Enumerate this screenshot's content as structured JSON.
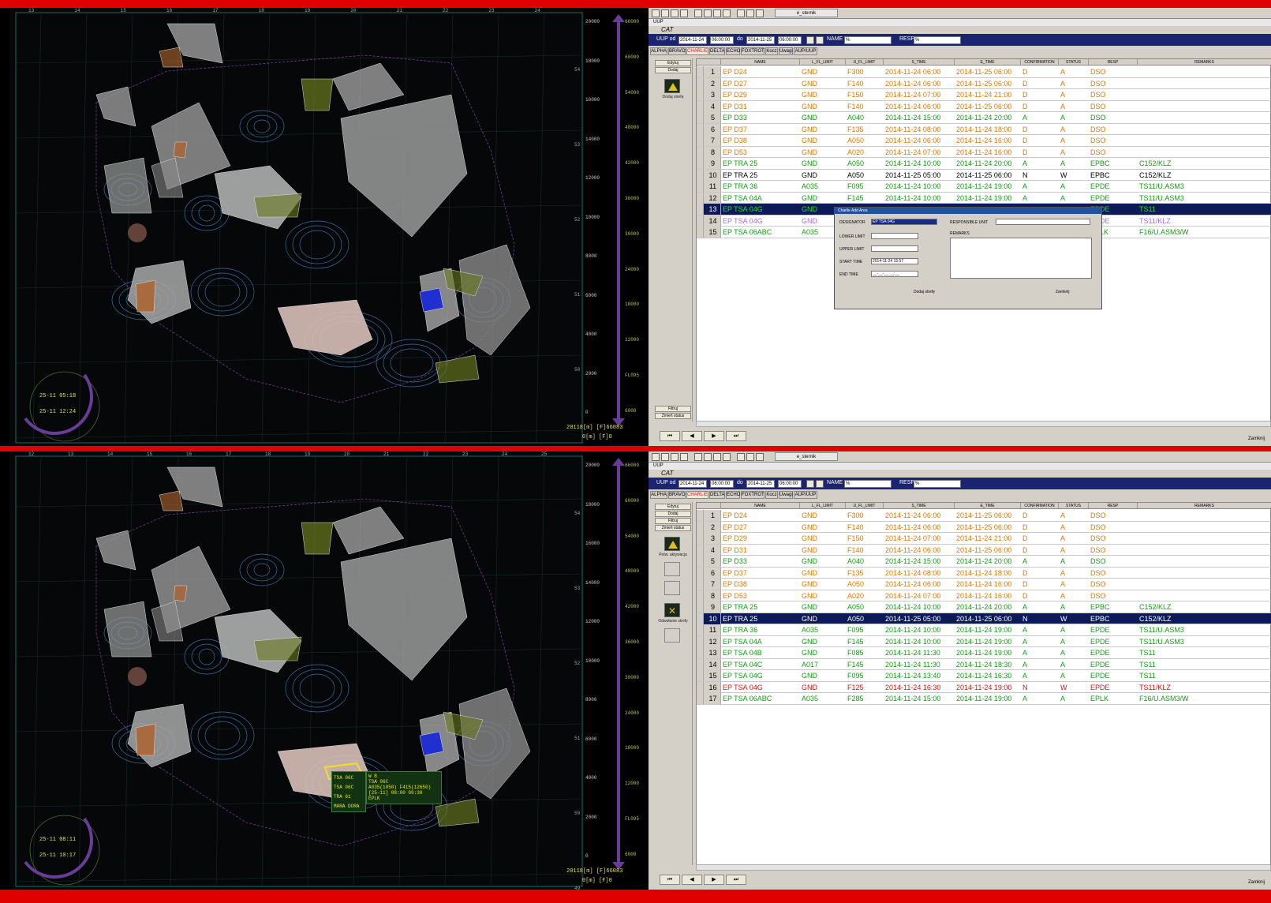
{
  "panes": [
    {
      "map": {
        "lat_labels": [
          "54",
          "53",
          "52",
          "51",
          "50"
        ],
        "lon_labels": [
          "13",
          "14",
          "15",
          "16",
          "17",
          "18",
          "19",
          "20",
          "21",
          "22",
          "23",
          "24"
        ],
        "scale_m": [
          "20000",
          "18000",
          "16000",
          "14000",
          "12000",
          "10000",
          "8000",
          "6000",
          "4000",
          "2000",
          "0"
        ],
        "scale_ft": [
          "66000",
          "60000",
          "54000",
          "48000",
          "42000",
          "36000",
          "30000",
          "24000",
          "18000",
          "12000",
          "FL095",
          "6000"
        ],
        "readout1": "20118[m] [F]66083",
        "readout2": "0[m] [F]0",
        "clock1": "25-11 05:18",
        "clock2": "25-11 12:24"
      },
      "app": {
        "window_title": "UUP",
        "title": "CAT",
        "uup_od_label": "UUP od",
        "date_from": "2014-11-24",
        "time_from": "06:00:00",
        "do_label": "do",
        "date_to": "2014-11-25",
        "time_to": "06:00:00",
        "name_label": "NAME",
        "name_value": "%",
        "resp_label": "RESP",
        "resp_value": "%",
        "user": "e_sternik",
        "tabs": [
          "ALPHA",
          "BRAVO",
          "CHARLIE",
          "DELTA",
          "ECHO",
          "FOXTROT",
          "Kocz",
          "Uwagi",
          "AUP/UUP"
        ],
        "side_buttons": [
          "Edytuj",
          "Dodaj"
        ],
        "side_icon_label": "Dodaj strefę",
        "side_bottom": [
          "Filtruj",
          "Zmień status"
        ],
        "columns": [
          "NAME",
          "L_FL_LIMIT",
          "U_FL_LIMIT",
          "S_TIME",
          "E_TIME",
          "CONFIRMATION",
          "STATUS",
          "RESP",
          "REMARKS"
        ],
        "rows": [
          {
            "n": "1",
            "name": "EP D24",
            "l": "GND",
            "u": "F300",
            "s": "2014-11-24 06:00",
            "e": "2014-11-25 06:00",
            "c": "D",
            "st": "A",
            "r": "DSO",
            "rem": "",
            "color": "#e07800"
          },
          {
            "n": "2",
            "name": "EP D27",
            "l": "GND",
            "u": "F140",
            "s": "2014-11-24 06:00",
            "e": "2014-11-25 06:00",
            "c": "D",
            "st": "A",
            "r": "DSO",
            "rem": "",
            "color": "#e07800"
          },
          {
            "n": "3",
            "name": "EP D29",
            "l": "GND",
            "u": "F150",
            "s": "2014-11-24 07:00",
            "e": "2014-11-24 21:00",
            "c": "D",
            "st": "A",
            "r": "DSO",
            "rem": "",
            "color": "#e07800"
          },
          {
            "n": "4",
            "name": "EP D31",
            "l": "GND",
            "u": "F140",
            "s": "2014-11-24 06:00",
            "e": "2014-11-25 06:00",
            "c": "D",
            "st": "A",
            "r": "DSO",
            "rem": "",
            "color": "#e07800"
          },
          {
            "n": "5",
            "name": "EP D33",
            "l": "GND",
            "u": "A040",
            "s": "2014-11-24 15:00",
            "e": "2014-11-24 20:00",
            "c": "A",
            "st": "A",
            "r": "DSO",
            "rem": "",
            "color": "#10a010"
          },
          {
            "n": "6",
            "name": "EP D37",
            "l": "GND",
            "u": "F135",
            "s": "2014-11-24 08:00",
            "e": "2014-11-24 18:00",
            "c": "D",
            "st": "A",
            "r": "DSO",
            "rem": "",
            "color": "#e07800"
          },
          {
            "n": "7",
            "name": "EP D38",
            "l": "GND",
            "u": "A050",
            "s": "2014-11-24 06:00",
            "e": "2014-11-24 16:00",
            "c": "D",
            "st": "A",
            "r": "DSO",
            "rem": "",
            "color": "#e07800"
          },
          {
            "n": "8",
            "name": "EP D53",
            "l": "GND",
            "u": "A020",
            "s": "2014-11-24 07:00",
            "e": "2014-11-24 16:00",
            "c": "D",
            "st": "A",
            "r": "DSO",
            "rem": "",
            "color": "#e07800"
          },
          {
            "n": "9",
            "name": "EP TRA 25",
            "l": "GND",
            "u": "A050",
            "s": "2014-11-24 10:00",
            "e": "2014-11-24 20:00",
            "c": "A",
            "st": "A",
            "r": "EPBC",
            "rem": "C152/KLZ",
            "color": "#10a010"
          },
          {
            "n": "10",
            "name": "EP TRA 25",
            "l": "GND",
            "u": "A050",
            "s": "2014-11-25 05:00",
            "e": "2014-11-25 06:00",
            "c": "N",
            "st": "W",
            "r": "EPBC",
            "rem": "C152/KLZ",
            "color": "#000000"
          },
          {
            "n": "11",
            "name": "EP TRA 36",
            "l": "A035",
            "u": "F095",
            "s": "2014-11-24 10:00",
            "e": "2014-11-24 19:00",
            "c": "A",
            "st": "A",
            "r": "EPDE",
            "rem": "TS11/U.ASM3",
            "color": "#10a010"
          },
          {
            "n": "12",
            "name": "EP TSA 04A",
            "l": "GND",
            "u": "F145",
            "s": "2014-11-24 10:00",
            "e": "2014-11-24 19:00",
            "c": "A",
            "st": "A",
            "r": "EPDE",
            "rem": "TS11/U.ASM3",
            "color": "#10a010"
          },
          {
            "n": "13",
            "name": "EP TSA 04G",
            "l": "GND",
            "u": "",
            "s": "",
            "e": "",
            "c": "",
            "st": "",
            "r": "EPDE",
            "rem": "TS11",
            "color": "#10c010",
            "sel": true
          },
          {
            "n": "14",
            "name": "EP TSA 04G",
            "l": "GND",
            "u": "",
            "s": "",
            "e": "",
            "c": "",
            "st": "",
            "r": "EPDE",
            "rem": "TS11/KLZ",
            "color": "#a070e0"
          },
          {
            "n": "15",
            "name": "EP TSA 06ABC",
            "l": "A035",
            "u": "",
            "s": "",
            "e": "",
            "c": "",
            "st": "",
            "r": "EPLK",
            "rem": "F16/U.ASM3/W",
            "color": "#10a010"
          }
        ],
        "close_label": "Zamknij",
        "dialog": {
          "title": "Charlie Add Area",
          "designator_label": "DESIGNATOR",
          "designator_value": "EP TSA 04G",
          "lower_label": "LOWER LIMIT",
          "upper_label": "UPPER LIMIT",
          "start_label": "START TIME",
          "start_value": "2014-11-24 15:57",
          "end_label": "END TIME",
          "end_value": "__-__-__ __:__",
          "resp_unit_label": "RESPONSIBLE UNIT",
          "remarks_label": "REMARKS",
          "add_btn": "Dodaj strefę",
          "close_btn": "Zamknij"
        }
      }
    },
    {
      "map": {
        "lat_labels": [
          "54",
          "53",
          "52",
          "51",
          "50",
          "49"
        ],
        "lon_labels": [
          "12",
          "13",
          "14",
          "15",
          "16",
          "17",
          "18",
          "19",
          "20",
          "21",
          "22",
          "23",
          "24",
          "25"
        ],
        "scale_m": [
          "20000",
          "18000",
          "16000",
          "14000",
          "12000",
          "10000",
          "8000",
          "6000",
          "4000",
          "2000",
          "0"
        ],
        "scale_ft": [
          "66000",
          "60000",
          "54000",
          "48000",
          "42000",
          "36000",
          "30000",
          "24000",
          "18000",
          "12000",
          "FL095",
          "6000"
        ],
        "readout1": "20118[m] [F]66083",
        "readout2": "0[m] [F]0",
        "clock1": "25-11 08:11",
        "clock2": "25-11 10:17",
        "tooltip_list": [
          "TSA 06C",
          "TSA 06C",
          "TRA 61",
          "MARA DORA"
        ],
        "tooltip_info": [
          "W B",
          "TSA 06C",
          "A035(1050) F415(12650)",
          "[25-11] 08:00 09:30",
          "EPLK"
        ]
      },
      "app": {
        "window_title": "UUP",
        "title": "CAT",
        "uup_od_label": "UUP od",
        "date_from": "2014-11-24",
        "time_from": "06:00:00",
        "do_label": "do",
        "date_to": "2014-11-25",
        "time_to": "06:00:00",
        "name_label": "NAME",
        "name_value": "%",
        "resp_label": "RESP",
        "resp_value": "%",
        "user": "e_sternik",
        "tabs": [
          "ALPHA",
          "BRAVO",
          "CHARLIE",
          "DELTA",
          "ECHO",
          "FOXTROT",
          "Kocz",
          "Uwagi",
          "AUP/UUP"
        ],
        "side_buttons": [
          "Edytuj",
          "Dodaj",
          "Filtruj",
          "Zmień status"
        ],
        "side_icon_label": "Potw. aktywacja",
        "side_icon2_label": "Odwołanie strefy",
        "columns": [
          "NAME",
          "L_FL_LIMIT",
          "U_FL_LIMIT",
          "S_TIME",
          "E_TIME",
          "CONFIRMATION",
          "STATUS",
          "RESP",
          "REMARKS"
        ],
        "rows": [
          {
            "n": "1",
            "name": "EP D24",
            "l": "GND",
            "u": "F300",
            "s": "2014-11-24 06:00",
            "e": "2014-11-25 06:00",
            "c": "D",
            "st": "A",
            "r": "DSO",
            "rem": "",
            "color": "#e07800"
          },
          {
            "n": "2",
            "name": "EP D27",
            "l": "GND",
            "u": "F140",
            "s": "2014-11-24 06:00",
            "e": "2014-11-25 06:00",
            "c": "D",
            "st": "A",
            "r": "DSO",
            "rem": "",
            "color": "#e07800"
          },
          {
            "n": "3",
            "name": "EP D29",
            "l": "GND",
            "u": "F150",
            "s": "2014-11-24 07:00",
            "e": "2014-11-24 21:00",
            "c": "D",
            "st": "A",
            "r": "DSO",
            "rem": "",
            "color": "#e07800"
          },
          {
            "n": "4",
            "name": "EP D31",
            "l": "GND",
            "u": "F140",
            "s": "2014-11-24 06:00",
            "e": "2014-11-25 06:00",
            "c": "D",
            "st": "A",
            "r": "DSO",
            "rem": "",
            "color": "#e07800"
          },
          {
            "n": "5",
            "name": "EP D33",
            "l": "GND",
            "u": "A040",
            "s": "2014-11-24 15:00",
            "e": "2014-11-24 20:00",
            "c": "A",
            "st": "A",
            "r": "DSO",
            "rem": "",
            "color": "#10a010"
          },
          {
            "n": "6",
            "name": "EP D37",
            "l": "GND",
            "u": "F135",
            "s": "2014-11-24 08:00",
            "e": "2014-11-24 18:00",
            "c": "D",
            "st": "A",
            "r": "DSO",
            "rem": "",
            "color": "#e07800"
          },
          {
            "n": "7",
            "name": "EP D38",
            "l": "GND",
            "u": "A050",
            "s": "2014-11-24 06:00",
            "e": "2014-11-24 16:00",
            "c": "D",
            "st": "A",
            "r": "DSO",
            "rem": "",
            "color": "#e07800"
          },
          {
            "n": "8",
            "name": "EP D53",
            "l": "GND",
            "u": "A020",
            "s": "2014-11-24 07:00",
            "e": "2014-11-24 16:00",
            "c": "D",
            "st": "A",
            "r": "DSO",
            "rem": "",
            "color": "#e07800"
          },
          {
            "n": "9",
            "name": "EP TRA 25",
            "l": "GND",
            "u": "A050",
            "s": "2014-11-24 10:00",
            "e": "2014-11-24 20:00",
            "c": "A",
            "st": "A",
            "r": "EPBC",
            "rem": "C152/KLZ",
            "color": "#10a010"
          },
          {
            "n": "10",
            "name": "EP TRA 25",
            "l": "GND",
            "u": "A050",
            "s": "2014-11-25 05:00",
            "e": "2014-11-25 06:00",
            "c": "N",
            "st": "W",
            "r": "EPBC",
            "rem": "C152/KLZ",
            "color": "#ffffff",
            "sel": true
          },
          {
            "n": "11",
            "name": "EP TRA 36",
            "l": "A035",
            "u": "F095",
            "s": "2014-11-24 10:00",
            "e": "2014-11-24 19:00",
            "c": "A",
            "st": "A",
            "r": "EPDE",
            "rem": "TS11/U.ASM3",
            "color": "#10a010"
          },
          {
            "n": "12",
            "name": "EP TSA 04A",
            "l": "GND",
            "u": "F145",
            "s": "2014-11-24 10:00",
            "e": "2014-11-24 19:00",
            "c": "A",
            "st": "A",
            "r": "EPDE",
            "rem": "TS11/U.ASM3",
            "color": "#10a010"
          },
          {
            "n": "13",
            "name": "EP TSA 04B",
            "l": "GND",
            "u": "F085",
            "s": "2014-11-24 11:30",
            "e": "2014-11-24 19:00",
            "c": "A",
            "st": "A",
            "r": "EPDE",
            "rem": "TS11",
            "color": "#10a010"
          },
          {
            "n": "14",
            "name": "EP TSA 04C",
            "l": "A017",
            "u": "F145",
            "s": "2014-11-24 11:30",
            "e": "2014-11-24 18:30",
            "c": "A",
            "st": "A",
            "r": "EPDE",
            "rem": "TS11",
            "color": "#10a010"
          },
          {
            "n": "15",
            "name": "EP TSA 04G",
            "l": "GND",
            "u": "F095",
            "s": "2014-11-24 13:40",
            "e": "2014-11-24 16:30",
            "c": "A",
            "st": "A",
            "r": "EPDE",
            "rem": "TS11",
            "color": "#10a010"
          },
          {
            "n": "16",
            "name": "EP TSA 04G",
            "l": "GND",
            "u": "F125",
            "s": "2014-11-24 16:30",
            "e": "2014-11-24 19:00",
            "c": "N",
            "st": "W",
            "r": "EPDE",
            "rem": "TS11/KLZ",
            "color": "#e01010"
          },
          {
            "n": "17",
            "name": "EP TSA 06ABC",
            "l": "A035",
            "u": "F285",
            "s": "2014-11-24 15:00",
            "e": "2014-11-24 19:00",
            "c": "A",
            "st": "A",
            "r": "EPLK",
            "rem": "F16/U.ASM3/W",
            "color": "#10a010"
          }
        ],
        "close_label": "Zamknij"
      }
    }
  ],
  "colors": {
    "frame": "#e00000",
    "selected_row": "#0c1a5a",
    "scale_bar": "#6a3c9a",
    "orange": "#e07800",
    "green": "#10a010"
  }
}
